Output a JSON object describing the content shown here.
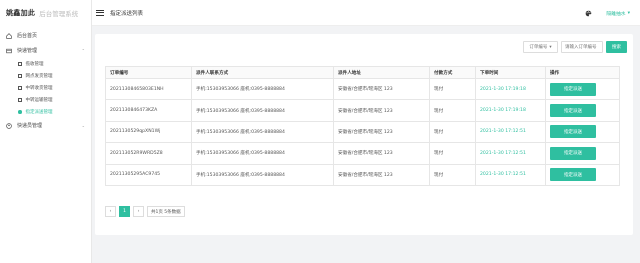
{
  "app": {
    "brand": "姚鑫加此",
    "system_name": "后台管理系统"
  },
  "colors": {
    "accent": "#2fbfa0"
  },
  "sidebar": {
    "items": [
      {
        "label": "后台首页",
        "icon": "home-icon"
      },
      {
        "label": "快递管理",
        "icon": "package-icon",
        "expanded": true,
        "children": [
          {
            "label": "揽收管理"
          },
          {
            "label": "网点发货管理"
          },
          {
            "label": "中转收货管理"
          },
          {
            "label": "中转运输管理"
          },
          {
            "label": "指定派送管理",
            "active": true
          }
        ]
      },
      {
        "label": "快递员管理",
        "icon": "courier-icon"
      }
    ]
  },
  "topbar": {
    "breadcrumb": "指定派送列表",
    "user": "隔離抽水"
  },
  "filters": {
    "select_label": "订单编号",
    "input_placeholder": "请输入订单编号",
    "search_label": "搜索"
  },
  "table": {
    "headers": [
      "订单编号",
      "派件人联系方式",
      "派件人地址",
      "付款方式",
      "下单时间",
      "操作"
    ],
    "action_label": "指定派送",
    "rows": [
      {
        "order_no": "20211308465803E1NH",
        "contact": "手机:15303953066 座机:0395-8888884",
        "address": "安徽省/合肥市/瑶海区 123",
        "payment": "现付",
        "time": "2021-1-30 17:19:18"
      },
      {
        "order_no": "2021130846473KZA",
        "contact": "手机:15303953066 座机:0395-8888884",
        "address": "安徽省/合肥市/瑶海区 123",
        "payment": "现付",
        "time": "2021-1-30 17:19:18"
      },
      {
        "order_no": "2021130529qpXN1Wj",
        "contact": "手机:15303953066 座机:0395-8888884",
        "address": "安徽省/合肥市/瑶海区 123",
        "payment": "现付",
        "time": "2021-1-30 17:12:51"
      },
      {
        "order_no": "202113052R9WRD5Z8",
        "contact": "手机:15303953066 座机:0395-8888884",
        "address": "安徽省/合肥市/瑶海区 123",
        "payment": "现付",
        "time": "2021-1-30 17:12:51"
      },
      {
        "order_no": "20211305295AC9745",
        "contact": "手机:15303953066 座机:0395-8888884",
        "address": "安徽省/合肥市/瑶海区 123",
        "payment": "现付",
        "time": "2021-1-30 17:12:51"
      }
    ]
  },
  "pagination": {
    "prev": "‹",
    "current": "1",
    "next": "›",
    "info": "共1页 5条数据"
  }
}
